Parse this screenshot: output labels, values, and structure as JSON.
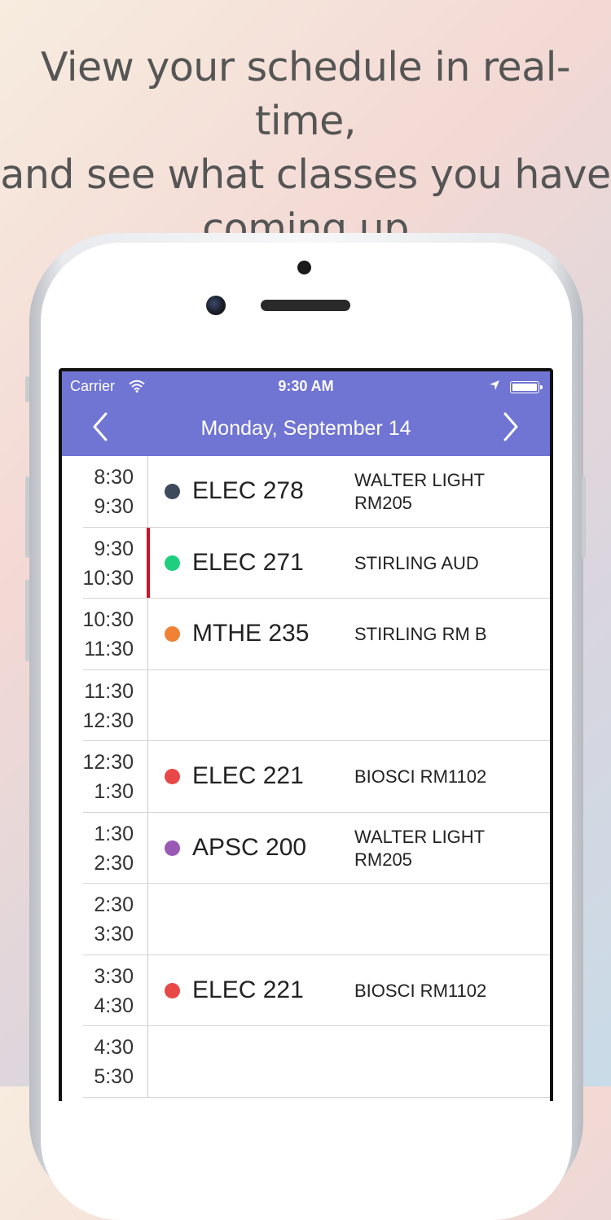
{
  "headline": {
    "line1": "View your schedule in real-time,",
    "line2": "and see what classes you have",
    "line3": "coming up"
  },
  "status_bar": {
    "carrier": "Carrier",
    "time": "9:30 AM"
  },
  "nav": {
    "title": "Monday, September 14",
    "back_icon": "chevron-left-icon",
    "forward_icon": "chevron-right-icon"
  },
  "colors": {
    "nav_bg": "#7074d3",
    "current_marker": "#c9142b"
  },
  "schedule": [
    {
      "start": "8:30",
      "end": "9:30",
      "course": "ELEC 278",
      "room": "WALTER LIGHT RM205",
      "color": "#3d4a5c",
      "active": false
    },
    {
      "start": "9:30",
      "end": "10:30",
      "course": "ELEC 271",
      "room": "STIRLING AUD",
      "color": "#1fcf7e",
      "active": true
    },
    {
      "start": "10:30",
      "end": "11:30",
      "course": "MTHE 235",
      "room": "STIRLING RM B",
      "color": "#ef8234",
      "active": false
    },
    {
      "start": "11:30",
      "end": "12:30",
      "course": "",
      "room": "",
      "color": "",
      "active": false
    },
    {
      "start": "12:30",
      "end": "1:30",
      "course": "ELEC 221",
      "room": "BIOSCI RM1102",
      "color": "#e84848",
      "active": false
    },
    {
      "start": "1:30",
      "end": "2:30",
      "course": "APSC 200",
      "room": "WALTER LIGHT RM205",
      "color": "#9b59b6",
      "active": false
    },
    {
      "start": "2:30",
      "end": "3:30",
      "course": "",
      "room": "",
      "color": "",
      "active": false
    },
    {
      "start": "3:30",
      "end": "4:30",
      "course": "ELEC 221",
      "room": "BIOSCI RM1102",
      "color": "#e84848",
      "active": false
    },
    {
      "start": "4:30",
      "end": "5:30",
      "course": "",
      "room": "",
      "color": "",
      "active": false
    }
  ]
}
